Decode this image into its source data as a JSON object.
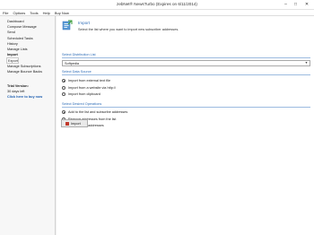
{
  "window": {
    "title": "zebNet® NewsTurbo (Expires on 6/11/2014)"
  },
  "menu": [
    "File",
    "Options",
    "Tools",
    "Help",
    "Buy Now"
  ],
  "sidebar": {
    "items": [
      {
        "label": "Dashboard"
      },
      {
        "label": "Compose Message"
      },
      {
        "label": "Send"
      },
      {
        "label": "Scheduled Tasks"
      },
      {
        "label": "History"
      },
      {
        "label": "Manage Lists"
      },
      {
        "label": "Import"
      },
      {
        "label": "Export"
      },
      {
        "label": "Manage Subscriptions"
      },
      {
        "label": "Manage Bounce Backs"
      }
    ],
    "trial": {
      "label": "Trial Version:",
      "days": "30 days left",
      "link": "Click here to buy now"
    }
  },
  "main": {
    "title": "Import",
    "description": "Select the list where you want to import new subscriber addresses.",
    "distribution": {
      "section_title": "Select Distribution List",
      "selected": "Softpedia"
    },
    "source": {
      "section_title": "Select Data Source",
      "options": [
        {
          "label": "Import from external text file",
          "selected": true
        },
        {
          "label": "Import from a website via http://",
          "selected": false
        },
        {
          "label": "Import from clipboard",
          "selected": false
        }
      ]
    },
    "operation": {
      "section_title": "Select Desired Operations",
      "options": [
        {
          "label": "Add to the list and subscribe addresses",
          "selected": true
        },
        {
          "label": "Remove addresses from the list",
          "selected": false
        },
        {
          "label": "Unsubscribe addresses",
          "selected": false
        }
      ]
    },
    "import_button": "Import"
  }
}
